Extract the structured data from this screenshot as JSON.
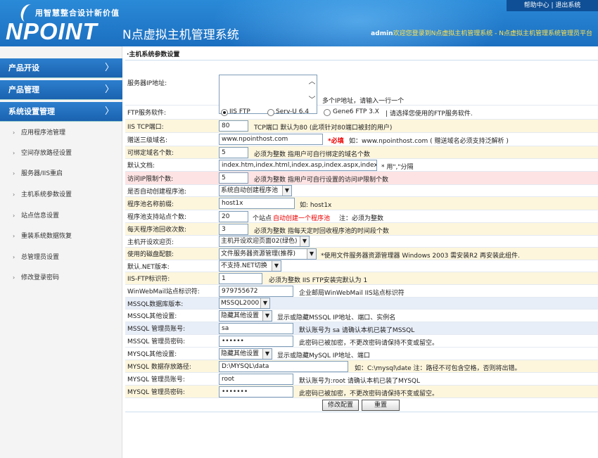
{
  "header": {
    "slogan": "用智慧整合设计新价值",
    "logo": "NPOINT",
    "app_title": "N点虚拟主机管理系统",
    "help": "帮助中心",
    "sep": " | ",
    "logout": "退出系统",
    "user": "admin",
    "welcome": "欢迎您登录到N点虚拟主机管理系统 - N点虚拟主机管理系统管理员平台"
  },
  "sidebar": {
    "main": [
      "产品开设",
      "产品管理",
      "系统设置管理"
    ],
    "sub": [
      "应用程序池管理",
      "空间存放路径设置",
      "服务器/IIS重启",
      "主机系统参数设置",
      "站点信息设置",
      "重装系统数据恢复",
      "总管理员设置",
      "修改登录密码"
    ]
  },
  "page": {
    "title": "·主机系统参数设置"
  },
  "form": {
    "ip_label": "服务器IP地址:",
    "ip_hint": "多个IP地址，请输入一行一个",
    "ftp_label": "FTP服务软件:",
    "ftp_opt1": "IIS FTP",
    "ftp_opt2": "Serv-U 6.4",
    "ftp_opt3": "Gene6 FTP 3.X",
    "ftp_hint": "| 请选择您使用的FTP服务软件.",
    "tcp_label": "IIS TCP端口:",
    "tcp_value": "80",
    "tcp_hint": "TCP端口 默认为80 (此项针对80端口被封的用户)",
    "domain_label": "赠送三级域名:",
    "domain_value": "www.npointhost.com",
    "domain_req": "*必填",
    "domain_hint": "如：www.npointhost.com ( 赠送域名必须支持泛解析 )",
    "bind_label": "可绑定域名个数:",
    "bind_value": "5",
    "bind_hint": "必须为整数 指用户可自行绑定的域名个数",
    "doc_label": "默认文档:",
    "doc_value": "index.htm,index.html,index.asp,index.aspx,index.php",
    "doc_hint": "* 用\",\"分隔",
    "visit_label": "访问IP限制个数:",
    "visit_value": "5",
    "visit_hint": "必须为整数 指用户可自行设置的访问IP限制个数",
    "pool_label": "是否自动创建程序池:",
    "pool_value": "系统自动创建程序池",
    "prefix_label": "程序池名称前缀:",
    "prefix_value": "host1x",
    "prefix_hint": "如: host1x",
    "sites_label": "程序池支持站点个数:",
    "sites_value": "20",
    "sites_hint1": "个站点",
    "sites_hint2": "自动创建一个程序池",
    "sites_hint3": "注：必须为整数",
    "recycle_label": "每天程序池回收次数:",
    "recycle_value": "3",
    "recycle_hint": "必须为整数 指每天定时回收程序池的时间段个数",
    "welcome_label": "主机开设欢迎页:",
    "welcome_value": "主机开设欢迎页面02(绿色)",
    "disk_label": "使用的磁盘配额:",
    "disk_value": "文件服务器资源管理(推荐)",
    "disk_hint": "*使用文件服务器资源管理器 Windows 2003 需安装R2 再安装此组件.",
    "net_label": "默认.NET版本:",
    "net_value": "不支持.NET切换",
    "iisftp_label": "IIS-FTP标识符:",
    "iisftp_value": "1",
    "iisftp_hint": "必须为整数 IIS FTP安装完默认为 1",
    "wm_label": "WinWebMail站点标识符:",
    "wm_value": "979755672",
    "wm_hint": "企业邮局WinWebMail IIS站点标识符",
    "mssqlver_label": "MSSQL数据库版本:",
    "mssqlver_value": "MSSQL2000",
    "mssqlother_label": "MSSQL其他设置:",
    "mssqlother_value": "隐藏其他设置",
    "mssqlother_hint": "显示或隐藏MSSQL IP地址、端口、实例名",
    "mssqluser_label": "MSSQL 管理员账号:",
    "mssqluser_value": "sa",
    "mssqluser_hint": "默认账号为 sa 请确认本机已装了MSSQL",
    "mssqlpwd_label": "MSSQL 管理员密码:",
    "mssqlpwd_value": "••••••",
    "mssqlpwd_hint": "此密码已被加密，不更改密码请保持不变或留空。",
    "mysqlother_label": "MYSQL其他设置:",
    "mysqlother_value": "隐藏其他设置",
    "mysqlother_hint": "显示或隐藏MySQL IP地址、端口",
    "mysqlpath_label": "MYSQL 数据存放路径:",
    "mysqlpath_value": "D:\\MYSQL\\data",
    "mysqlpath_hint": "如：C:\\mysql\\date 注：路径不可包含空格，否则将出错。",
    "mysqluser_label": "MYSQL 管理员账号:",
    "mysqluser_value": "root",
    "mysqluser_hint": "默认账号为:root 请确认本机已装了MYSQL",
    "mysqlpwd_label": "MYSQL 管理员密码:",
    "mysqlpwd_value": "•••••••",
    "mysqlpwd_hint": "此密码已被加密，不更改密码请保持不变或留空。",
    "save": "修改配置",
    "reset": "重置"
  }
}
